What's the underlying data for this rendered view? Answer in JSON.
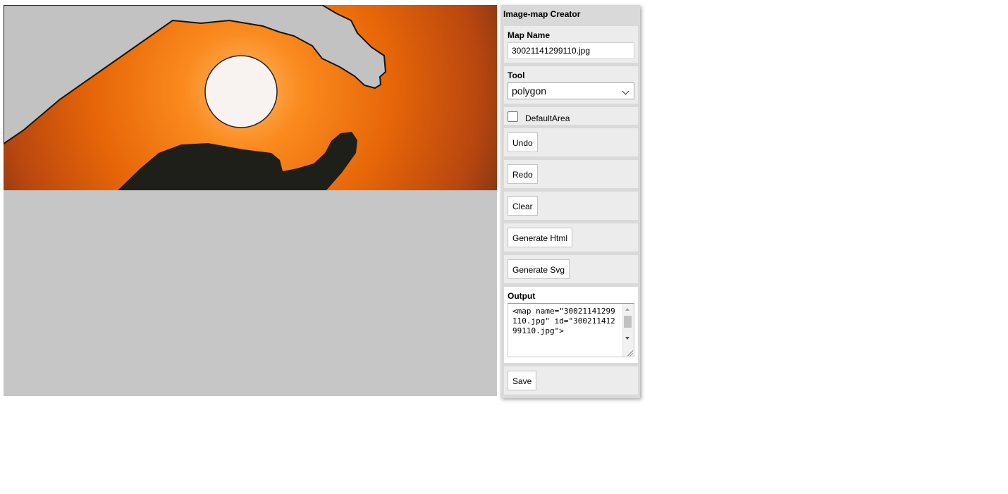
{
  "panel": {
    "title": "Image-map Creator",
    "map_name": {
      "label": "Map Name",
      "value": "30021141299110.jpg"
    },
    "tool": {
      "label": "Tool",
      "selected": "polygon"
    },
    "default_area": {
      "label": "DefaultArea",
      "checked": false
    },
    "buttons": {
      "undo": "Undo",
      "redo": "Redo",
      "clear": "Clear",
      "generate_html": "Generate Html",
      "generate_svg": "Generate Svg",
      "save": "Save"
    },
    "output": {
      "label": "Output",
      "text": "<map name=\"30021141299110.jpg\" id=\"30021141299110.jpg\">"
    }
  },
  "image": {
    "icon": "photo-sun-hands"
  }
}
